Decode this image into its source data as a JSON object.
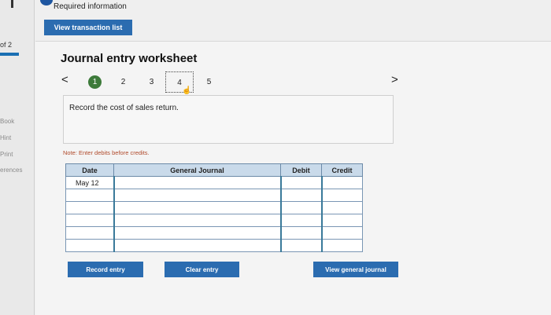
{
  "left_nav": {
    "page_indicator": "of 2",
    "links": [
      "Book",
      "Hint",
      "Print",
      "erences"
    ]
  },
  "header": {
    "required_information": "Required information",
    "view_transaction_list": "View transaction list"
  },
  "worksheet": {
    "title": "Journal entry worksheet",
    "prev_arrow": "<",
    "next_arrow": ">",
    "steps": [
      "1",
      "2",
      "3",
      "4",
      "5"
    ],
    "active_step": "1",
    "instruction": "Record the cost of sales return.",
    "note": "Note: Enter debits before credits."
  },
  "journal": {
    "headers": {
      "date": "Date",
      "general_journal": "General Journal",
      "debit": "Debit",
      "credit": "Credit"
    },
    "rows": [
      {
        "date": "May 12",
        "account": "",
        "debit": "",
        "credit": ""
      },
      {
        "date": "",
        "account": "",
        "debit": "",
        "credit": ""
      },
      {
        "date": "",
        "account": "",
        "debit": "",
        "credit": ""
      },
      {
        "date": "",
        "account": "",
        "debit": "",
        "credit": ""
      },
      {
        "date": "",
        "account": "",
        "debit": "",
        "credit": ""
      },
      {
        "date": "",
        "account": "",
        "debit": "",
        "credit": ""
      }
    ]
  },
  "actions": {
    "record_entry": "Record entry",
    "clear_entry": "Clear entry",
    "view_general_journal": "View general journal"
  },
  "colors": {
    "primary_button": "#2b6cb0",
    "active_step": "#3d7a3a",
    "table_header": "#c9daea",
    "note_text": "#b04a2b"
  }
}
